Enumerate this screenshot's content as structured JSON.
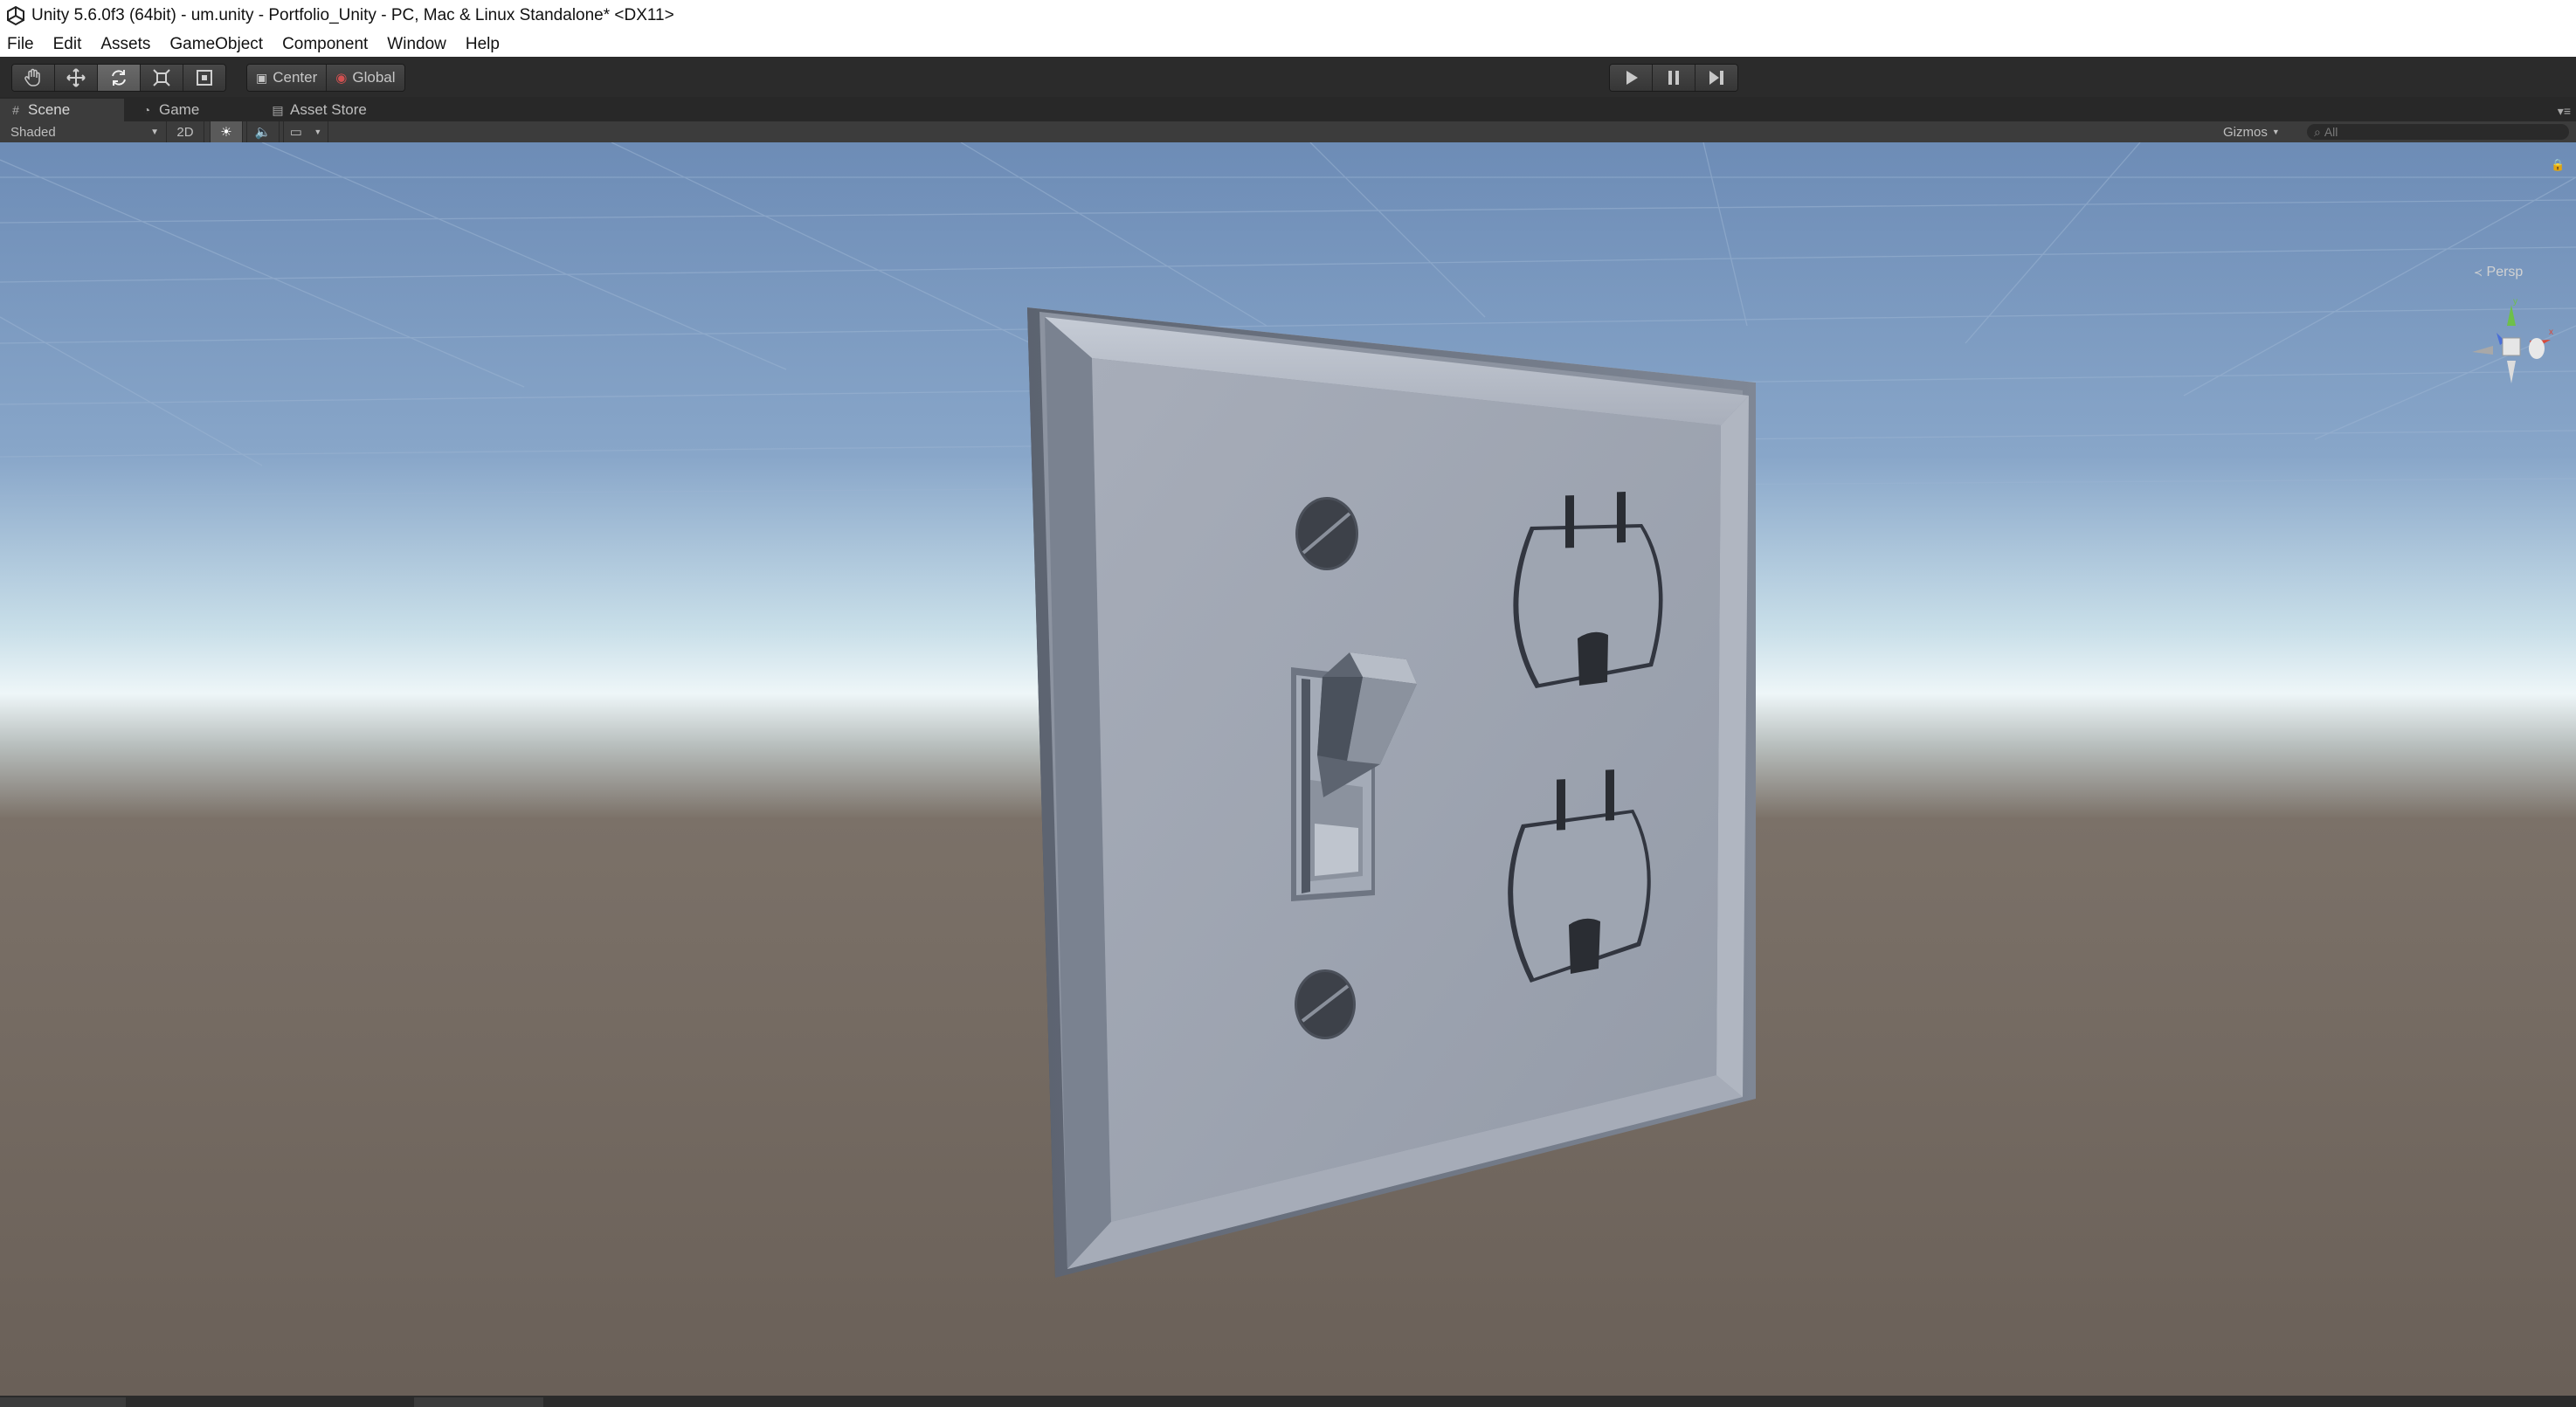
{
  "window": {
    "title": "Unity 5.6.0f3 (64bit) - um.unity - Portfolio_Unity - PC, Mac & Linux Standalone* <DX11>"
  },
  "menu": {
    "items": [
      "File",
      "Edit",
      "Assets",
      "GameObject",
      "Component",
      "Window",
      "Help"
    ]
  },
  "toolbar": {
    "transform_tools": [
      "hand-tool",
      "move-tool",
      "rotate-tool",
      "scale-tool",
      "rect-tool"
    ],
    "active_tool": "rotate-tool",
    "pivot_mode": "Center",
    "pivot_rotation": "Global",
    "playback": [
      "play",
      "pause",
      "step"
    ]
  },
  "tabs": {
    "scene": "Scene",
    "game": "Game",
    "asset_store": "Asset Store",
    "active": "Scene"
  },
  "scene_toolbar": {
    "draw_mode": "Shaded",
    "mode_2d": "2D",
    "lighting": "sun-icon",
    "audio": "speaker-icon",
    "effects": "image-icon",
    "gizmos": "Gizmos",
    "search_placeholder": "All"
  },
  "viewport": {
    "projection": "Persp",
    "scene_object": "light switch and duplex outlet wall plate"
  },
  "colors": {
    "toolbar_bg": "#2b2b2b",
    "sky_top": "#6f8fba",
    "horizon": "#e8f2f6",
    "ground": "#675e55",
    "plate": "#9aa1ae"
  }
}
